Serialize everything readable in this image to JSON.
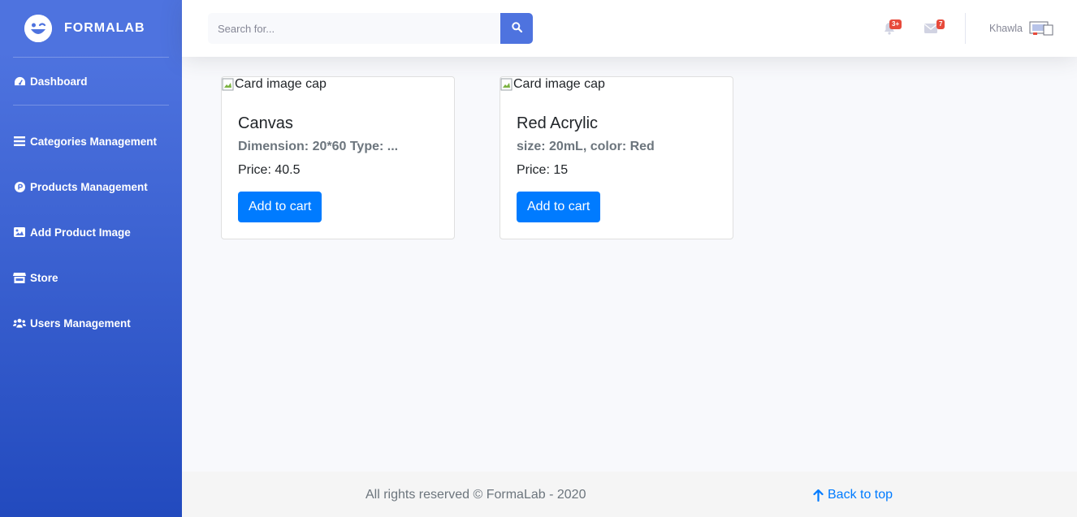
{
  "brand": {
    "name": "FORMALAB",
    "logo_icon": "laugh-wink-icon"
  },
  "sidebar": {
    "dashboard": {
      "label": "Dashboard",
      "icon": "tachometer-icon"
    },
    "items": [
      {
        "label": "Categories Management",
        "icon": "list-icon"
      },
      {
        "label": "Products Management",
        "icon": "product-hunt-icon"
      },
      {
        "label": "Add Product Image",
        "icon": "image-icon"
      },
      {
        "label": "Store",
        "icon": "store-icon"
      },
      {
        "label": "Users Management",
        "icon": "users-icon"
      }
    ]
  },
  "topbar": {
    "search_placeholder": "Search for...",
    "search_icon": "search-icon",
    "alerts_badge": "3+",
    "messages_badge": "7",
    "user_name": "Khawla"
  },
  "products": [
    {
      "image_alt": "Card image cap",
      "title": "Canvas",
      "subtitle": "Dimension: 20*60 Type: ...",
      "price": "Price: 40.5",
      "button": "Add to cart"
    },
    {
      "image_alt": "Card image cap",
      "title": "Red Acrylic",
      "subtitle": "size: 20mL, color: Red",
      "price": "Price: 15",
      "button": "Add to cart"
    }
  ],
  "footer": {
    "copyright": "All rights reserved © FormaLab - 2020",
    "back_to_top": "Back to top"
  },
  "colors": {
    "primary": "#4e73df",
    "primary_dark": "#224abe",
    "button": "#007bff",
    "badge": "#e74a3b"
  }
}
